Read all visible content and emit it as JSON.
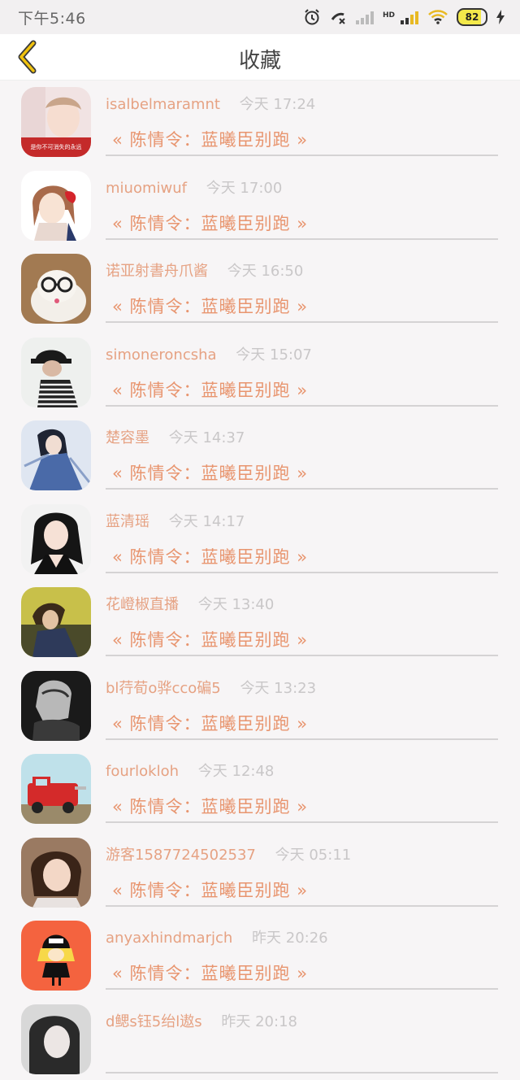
{
  "status_bar": {
    "time": "下午5:46",
    "hd": "HD",
    "battery": "82",
    "icons": [
      "alarm-icon",
      "phone-missed-icon",
      "signal-weak-icon",
      "signal-icon",
      "wifi-icon",
      "battery-icon",
      "charging-icon"
    ]
  },
  "header": {
    "title": "收藏",
    "back_icon": "chevron-left-icon",
    "accent": "#f0c20e"
  },
  "colors": {
    "username": "#e6a283",
    "time": "#c9c7c8",
    "title": "#e8956f"
  },
  "items": [
    {
      "user": "isalbelmaramnt",
      "time": "今天 17:24",
      "title": "« 陈情令：蓝曦臣别跑 »",
      "avatar_overlay": "是你不可消失的永远"
    },
    {
      "user": "miuomiwuf",
      "time": "今天 17:00",
      "title": "« 陈情令：蓝曦臣别跑 »"
    },
    {
      "user": "诺亚射書舟爪酱",
      "time": "今天 16:50",
      "title": "« 陈情令：蓝曦臣别跑 »"
    },
    {
      "user": "simoneroncsha",
      "time": "今天 15:07",
      "title": "« 陈情令：蓝曦臣别跑 »"
    },
    {
      "user": "楚容墨",
      "time": "今天 14:37",
      "title": "« 陈情令：蓝曦臣别跑 »"
    },
    {
      "user": "蓝清瑶",
      "time": "今天 14:17",
      "title": "« 陈情令：蓝曦臣别跑 »"
    },
    {
      "user": "花嶝椒直播",
      "time": "今天 13:40",
      "title": "« 陈情令：蓝曦臣别跑 »"
    },
    {
      "user": "bl荇荀o骅cco碥5",
      "time": "今天 13:23",
      "title": "« 陈情令：蓝曦臣别跑 »"
    },
    {
      "user": "fourlokloh",
      "time": "今天 12:48",
      "title": "« 陈情令：蓝曦臣别跑 »"
    },
    {
      "user": "游客1587724502537",
      "time": "今天 05:11",
      "title": "« 陈情令：蓝曦臣别跑 »"
    },
    {
      "user": "anyaxhindmarjch",
      "time": "昨天 20:26",
      "title": "« 陈情令：蓝曦臣别跑 »"
    },
    {
      "user": "d鳃s钰5绐l遨s",
      "time": "昨天 20:18",
      "title": ""
    }
  ]
}
